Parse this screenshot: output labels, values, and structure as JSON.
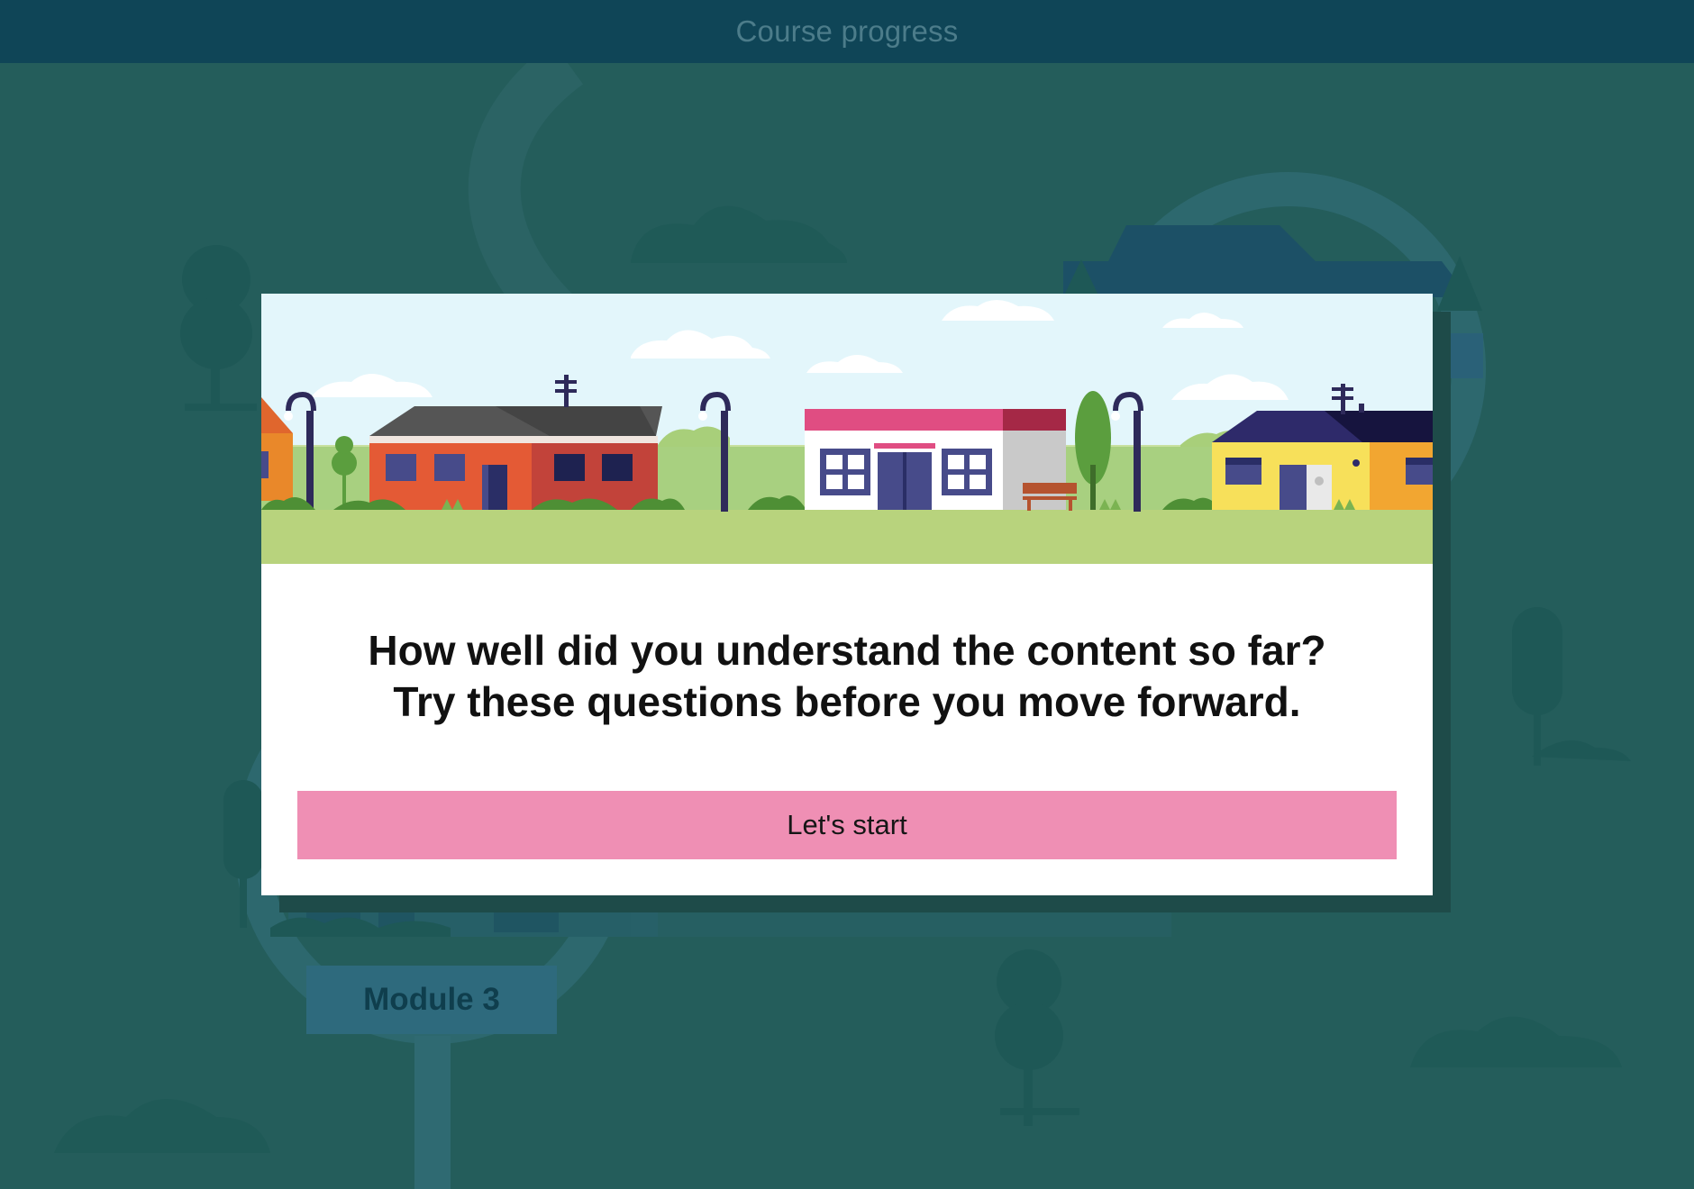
{
  "header": {
    "title": "Course progress"
  },
  "background": {
    "module_label": "Module 3"
  },
  "modal": {
    "heading_line1": "How well did you understand the content so far?",
    "heading_line2": "Try these questions before you move forward.",
    "start_button_label": "Let's start"
  },
  "colors": {
    "page_background": "#245d5b",
    "header_background": "#0f4557",
    "modal_background": "#ffffff",
    "button_background": "#ef8fb4",
    "illustration_sky": "#e3f6fb",
    "illustration_grass": "#b8d37d"
  }
}
